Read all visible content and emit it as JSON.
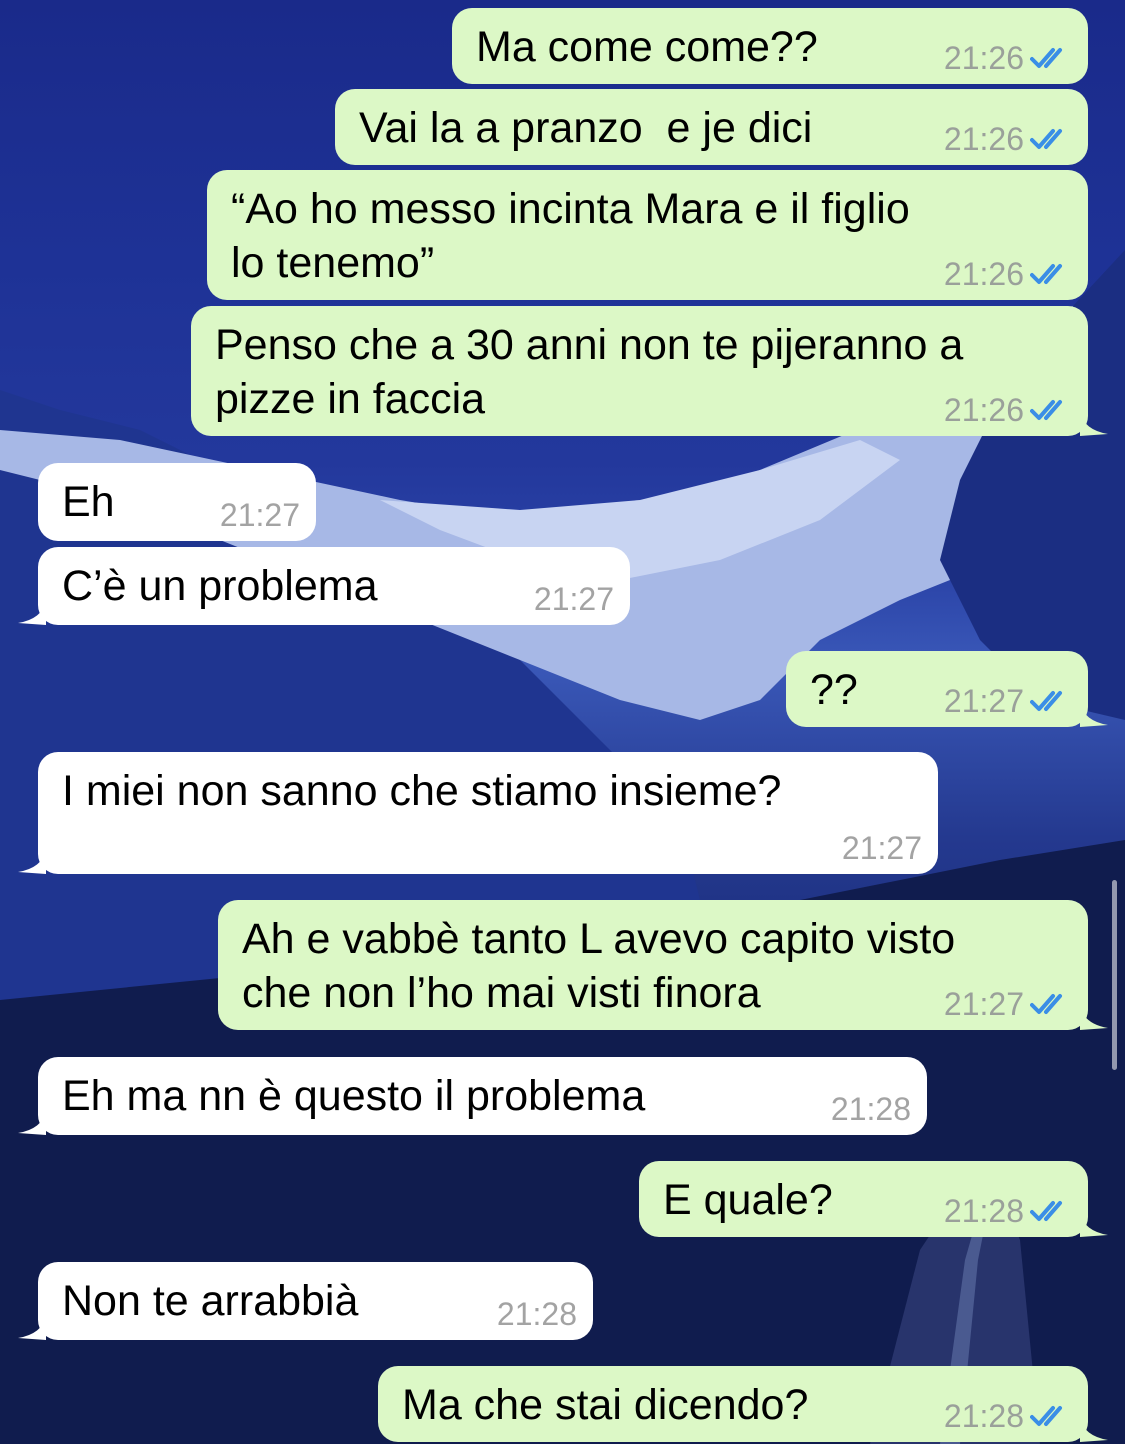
{
  "colors": {
    "outgoing_bubble": "#dcf8c6",
    "incoming_bubble": "#ffffff",
    "read_ticks": "#3a8ee6",
    "timestamp": "#9aa09a"
  },
  "icons": {
    "read_receipt": "double-check-icon"
  },
  "messages": [
    {
      "direction": "out",
      "text": "Ma come come??",
      "time": "21:26",
      "status": "read"
    },
    {
      "direction": "out",
      "text": "Vai la a pranzo  e je dici",
      "time": "21:26",
      "status": "read"
    },
    {
      "direction": "out",
      "text": "“Ao ho messo incinta Mara e il figlio\nlo tenemo”",
      "time": "21:26",
      "status": "read"
    },
    {
      "direction": "out",
      "text": "Penso che a 30 anni non te pijeranno a\npizze in faccia",
      "time": "21:26",
      "status": "read"
    },
    {
      "direction": "in",
      "text": "Eh",
      "time": "21:27"
    },
    {
      "direction": "in",
      "text": "C’è un problema",
      "time": "21:27"
    },
    {
      "direction": "out",
      "text": "??",
      "time": "21:27",
      "status": "read"
    },
    {
      "direction": "in",
      "text": "I miei non sanno che stiamo insieme?",
      "time": "21:27"
    },
    {
      "direction": "out",
      "text": "Ah e vabbè tanto L avevo capito visto\nche non l’ho mai visti finora",
      "time": "21:27",
      "status": "read"
    },
    {
      "direction": "in",
      "text": "Eh ma nn è questo il problema",
      "time": "21:28"
    },
    {
      "direction": "out",
      "text": "E quale?",
      "time": "21:28",
      "status": "read"
    },
    {
      "direction": "in",
      "text": "Non te arrabbià",
      "time": "21:28"
    },
    {
      "direction": "out",
      "text": "Ma che stai dicendo?",
      "time": "21:28",
      "status": "read"
    }
  ]
}
